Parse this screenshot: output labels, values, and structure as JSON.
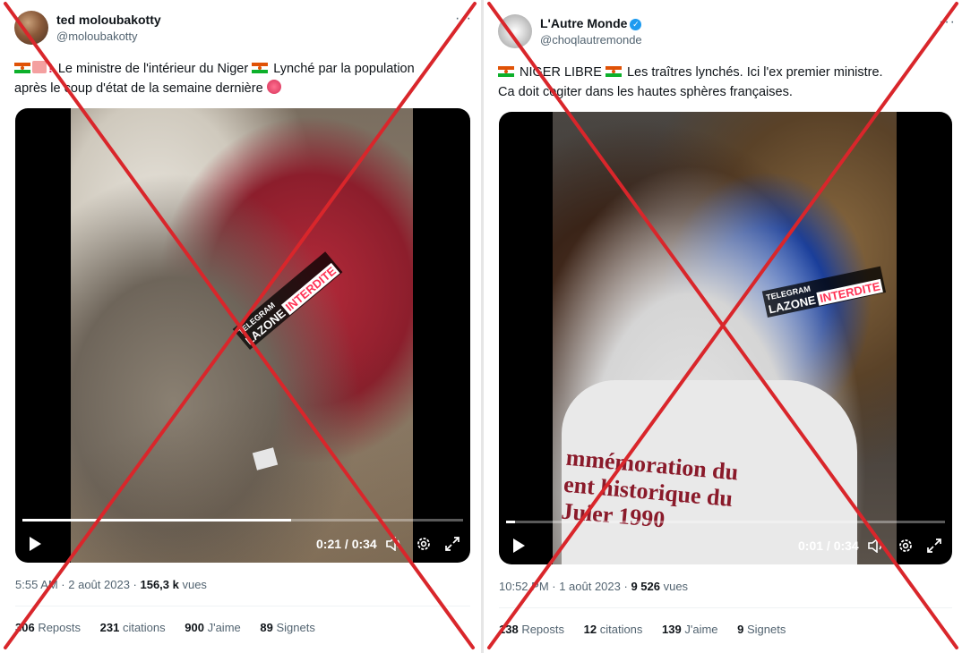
{
  "left_tweet": {
    "author_name": "ted moloubakotty",
    "author_handle": "@moloubakotty",
    "more_label": "···",
    "text_line1": "Le ministre de l'intérieur du Niger",
    "text_line1b": "Lynché par la population",
    "text_line2": "après le coup d'état de la semaine dernière",
    "excl": "!",
    "watermark_top": "TELEGRAM",
    "watermark_brand": "LAZONE",
    "watermark_hl": "INTERDITE",
    "timecode": "0:21 / 0:34",
    "progress": 0.61,
    "timestamp": "5:55 AM · 2 août 2023 · ",
    "views_count": "156,3 k",
    "views_label": " vues",
    "reposts_count": "306",
    "reposts_label": " Reposts",
    "quotes_count": "231",
    "quotes_label": " citations",
    "likes_count": "900",
    "likes_label": " J'aime",
    "bookmarks_count": "89",
    "bookmarks_label": " Signets"
  },
  "right_tweet": {
    "author_name": "L'Autre Monde",
    "author_handle": "@choqlautremonde",
    "verified_mark": "✓",
    "more_label": "···",
    "text_line1a": "NIGER LIBRE",
    "text_line1b": "Les traîtres lynchés. Ici l'ex premier ministre.",
    "text_line2": "Ca doit cogiter dans les hautes sphères françaises.",
    "shirt_line1": "mmémoration du",
    "shirt_line2": "ent historique du",
    "shirt_line3": "Juier 1990",
    "watermark_top": "TELEGRAM",
    "watermark_brand": "LAZONE",
    "watermark_hl": "INTERDITE",
    "timecode": "0:01 / 0:34",
    "progress": 0.02,
    "timestamp": "10:52 PM · 1 août 2023 · ",
    "views_count": "9 526",
    "views_label": " vues",
    "reposts_count": "138",
    "reposts_label": " Reposts",
    "quotes_count": "12",
    "quotes_label": " citations",
    "likes_count": "139",
    "likes_label": " J'aime",
    "bookmarks_count": "9",
    "bookmarks_label": " Signets"
  },
  "icons": {
    "play": "play-icon",
    "volume": "volume-icon",
    "settings": "gear-icon",
    "fullscreen": "fullscreen-icon",
    "cross": "red-cross-mark"
  },
  "colors": {
    "cross_red": "#d9262b",
    "verified_blue": "#1d9bf0",
    "muted_text": "#536471"
  }
}
